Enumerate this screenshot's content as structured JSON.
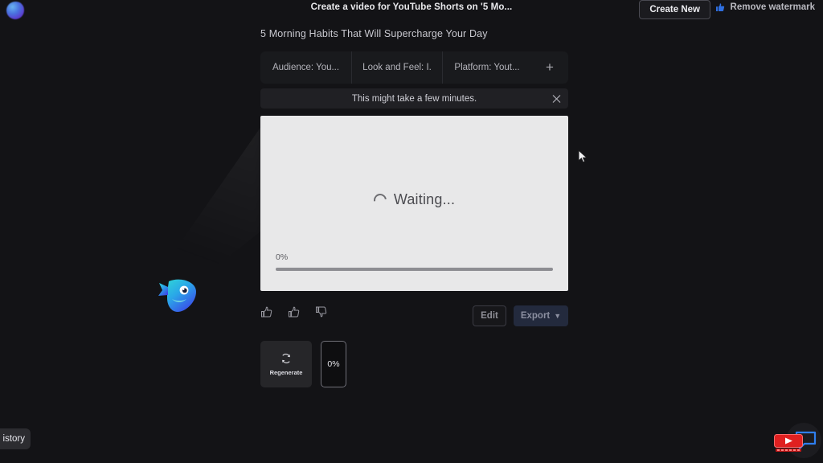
{
  "header": {
    "title": "Create a video for YouTube Shorts on '5 Mo...",
    "create_new_label": "Create New",
    "remove_watermark_label": "Remove watermark",
    "logo_icon": "app-orb-logo",
    "watermark_icon": "blue-badge-icon"
  },
  "subtitle": "5 Morning Habits That Will Supercharge Your Day",
  "chips": {
    "items": [
      {
        "label": "Audience: You..."
      },
      {
        "label": "Look and Feel: I."
      },
      {
        "label": "Platform: Yout..."
      }
    ],
    "add_label": "+"
  },
  "notice": {
    "message": "This might take a few minutes.",
    "close_icon": "close-icon"
  },
  "preview": {
    "status_text": "Waiting...",
    "spinner_icon": "loading-spinner-icon",
    "progress_percent_label": "0%",
    "progress_value": 0
  },
  "actions": {
    "thumbs": [
      {
        "icon": "thumbs-up-icon"
      },
      {
        "icon": "thumbs-up-alt-icon"
      },
      {
        "icon": "thumbs-down-icon"
      }
    ],
    "edit_label": "Edit",
    "export_label": "Export",
    "export_caret": "▼"
  },
  "cards": {
    "regenerate_label": "Regenerate",
    "regenerate_icon": "refresh-icon",
    "thumbnail_percent": "0%"
  },
  "mascot": {
    "icon": "fish-mascot-icon"
  },
  "history": {
    "label": "istory"
  },
  "overlay": {
    "chat_icon": "chat-bubble-icon",
    "youtube_icon": "youtube-subscribe-icon"
  },
  "cursor": {
    "icon": "mouse-pointer-icon"
  },
  "colors": {
    "page_bg": "#131316",
    "panel_bg": "#e8e8e9",
    "accent_export": "#232a3d",
    "watermark_blue": "#2f6fe0",
    "youtube_red": "#e02020"
  }
}
